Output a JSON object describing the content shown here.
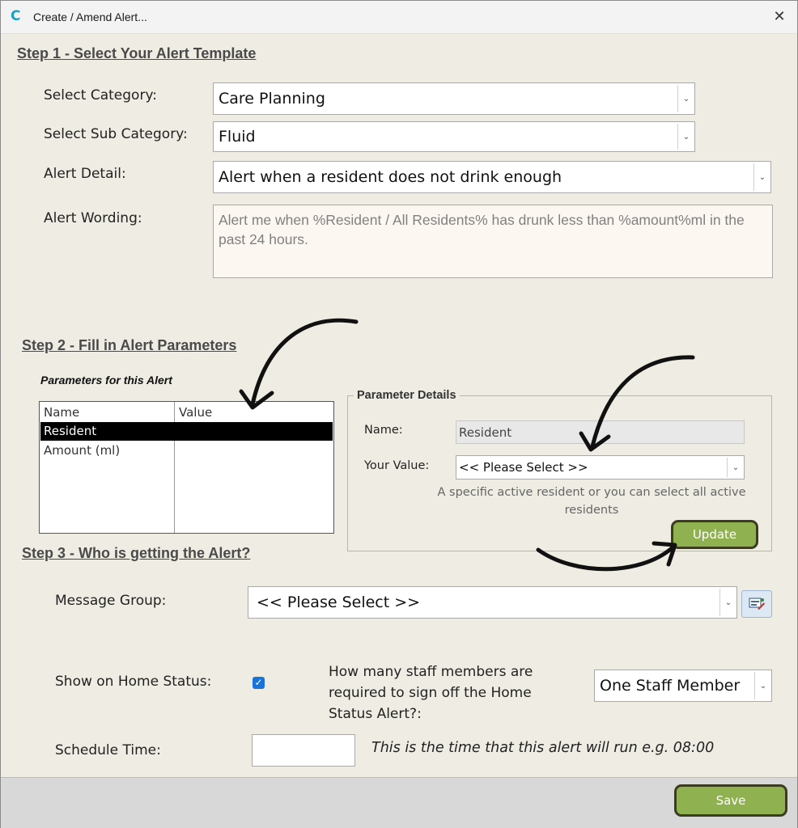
{
  "window": {
    "title": "Create / Amend Alert..."
  },
  "step1": {
    "title": "Step 1 - Select Your Alert Template",
    "category_label": "Select Category:",
    "category_value": "Care Planning",
    "subcategory_label": "Select Sub Category:",
    "subcategory_value": "Fluid",
    "detail_label": "Alert Detail:",
    "detail_value": "Alert when a resident does not drink enough",
    "wording_label": "Alert Wording:",
    "wording_value": "Alert me when %Resident / All Residents% has drunk less than %amount%ml in the past 24 hours."
  },
  "step2": {
    "title": "Step 2 - Fill in Alert Parameters",
    "params_heading": "Parameters for this Alert",
    "columns": [
      "Name",
      "Value"
    ],
    "rows": [
      {
        "name": "Resident",
        "value": "",
        "selected": true
      },
      {
        "name": "Amount (ml)",
        "value": "",
        "selected": false
      }
    ],
    "details": {
      "legend": "Parameter Details",
      "name_label": "Name:",
      "name_value": "Resident",
      "value_label": "Your Value:",
      "value_selected": "<< Please Select >>",
      "hint": "A specific active resident or you can select all active residents",
      "update_label": "Update"
    }
  },
  "step3": {
    "title": "Step 3 - Who is getting the Alert?",
    "message_group_label": "Message Group:",
    "message_group_value": "<< Please Select >>",
    "show_home_status_label": "Show on Home Status:",
    "show_home_status_checked": true,
    "staff_question": "How many staff members are required to sign off the Home Status Alert?:",
    "staff_value": "One Staff Member",
    "schedule_label": "Schedule Time:",
    "schedule_value": "",
    "schedule_note": "This is the time that this alert will run e.g. 08:00"
  },
  "footer": {
    "save_label": "Save"
  },
  "colors": {
    "accent_green": "#8fb150",
    "background": "#eeece3",
    "checkbox_blue": "#1a73d9"
  }
}
